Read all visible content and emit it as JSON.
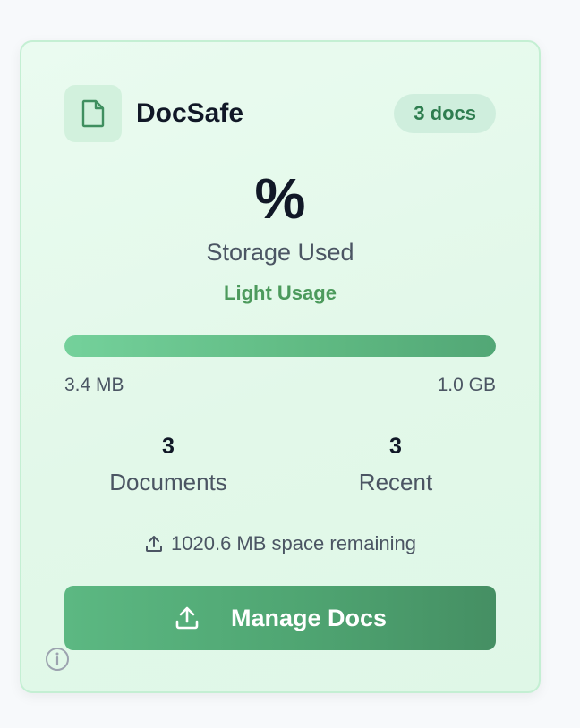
{
  "app": {
    "title": "DocSafe",
    "icon": "document-icon"
  },
  "badge": {
    "label": "3 docs"
  },
  "storage": {
    "percent_text": "%",
    "label": "Storage Used",
    "usage_level": "Light Usage",
    "used": "3.4 MB",
    "total": "1.0 GB",
    "bar_fill_fraction": 1.0,
    "remaining_text": "1020.6 MB space remaining",
    "remaining_icon": "upload-icon"
  },
  "stats": {
    "documents": {
      "value": "3",
      "label": "Documents"
    },
    "recent": {
      "value": "3",
      "label": "Recent"
    }
  },
  "actions": {
    "manage_label": "Manage Docs",
    "manage_icon": "upload-icon"
  },
  "footer": {
    "info_icon": "info-icon"
  },
  "colors": {
    "accent": "#4fa572",
    "usage_text": "#4c9a5c",
    "card_border": "#c4efd3"
  }
}
